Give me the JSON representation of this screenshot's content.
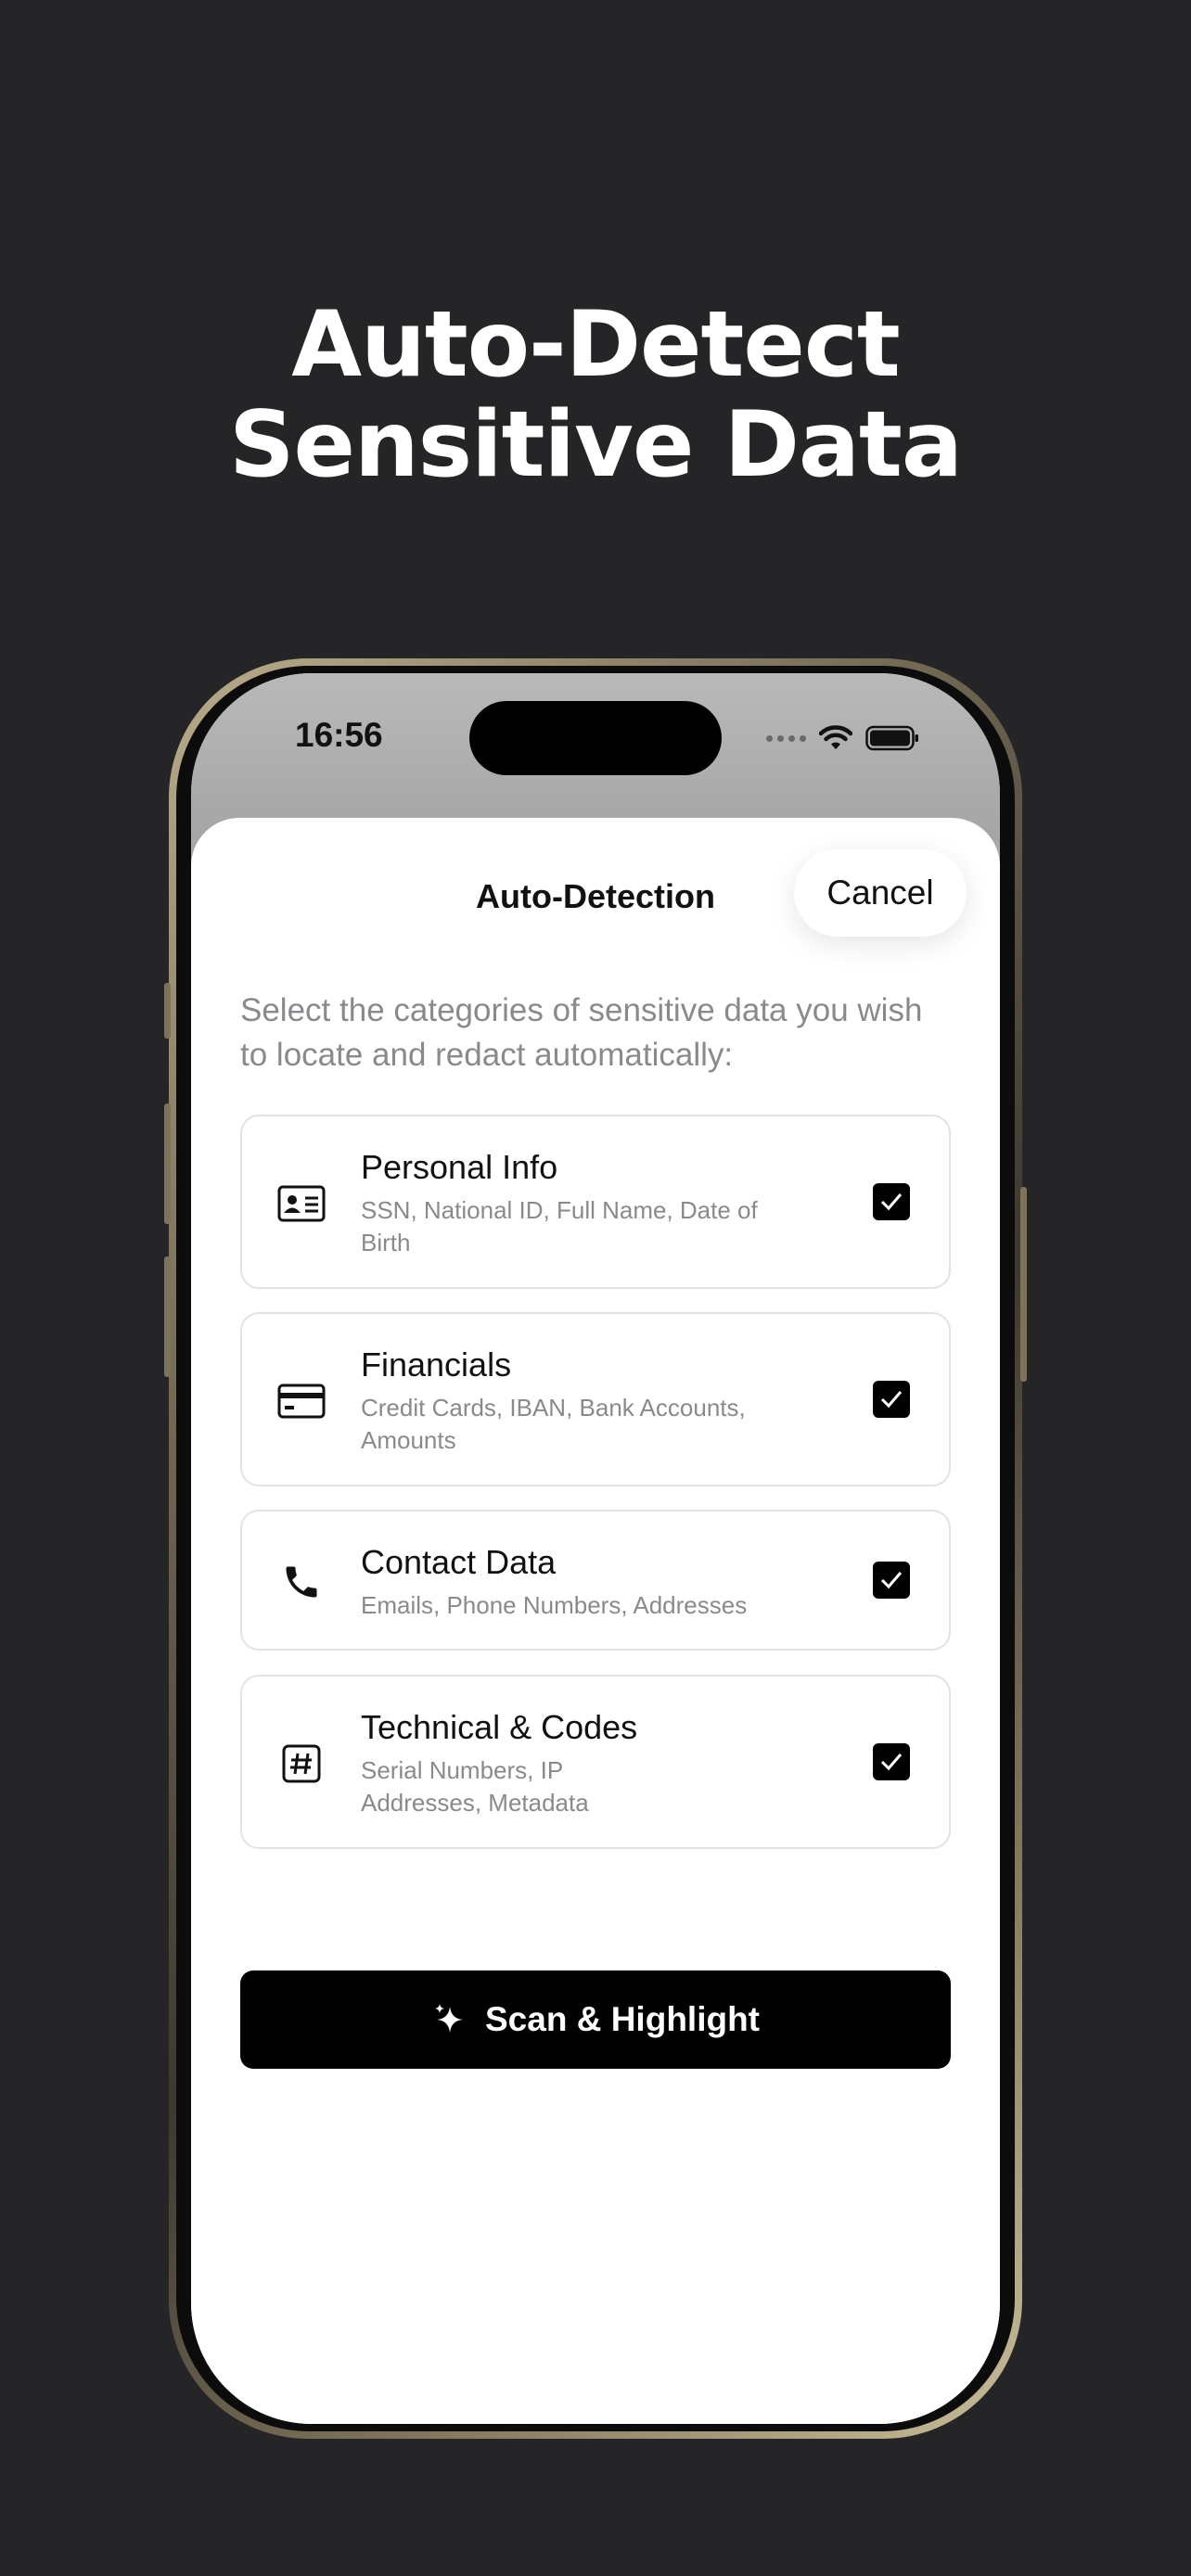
{
  "headline": {
    "line1": "Auto-Detect",
    "line2": "Sensitive Data"
  },
  "status_bar": {
    "time": "16:56"
  },
  "sheet": {
    "title": "Auto-Detection",
    "cancel_label": "Cancel",
    "intro": "Select the categories of sensitive data you wish to locate and redact automatically:"
  },
  "categories": [
    {
      "title": "Personal Info",
      "description": "SSN, National ID, Full Name, Date of Birth",
      "icon": "id-card-icon",
      "checked": true
    },
    {
      "title": "Financials",
      "description": "Credit Cards, IBAN, Bank Accounts, Amounts",
      "icon": "credit-card-icon",
      "checked": true
    },
    {
      "title": "Contact Data",
      "description": "Emails, Phone Numbers, Addresses",
      "icon": "phone-icon",
      "checked": true
    },
    {
      "title": "Technical & Codes",
      "description": "Serial Numbers, IP Addresses, Metadata",
      "icon": "hashtag-icon",
      "checked": true
    }
  ],
  "scan_button": {
    "label": "Scan & Highlight",
    "icon": "sparkles-icon"
  },
  "colors": {
    "background": "#252527",
    "accent": "#000000",
    "sheet": "#ffffff",
    "muted_text": "#8a8a8e"
  }
}
